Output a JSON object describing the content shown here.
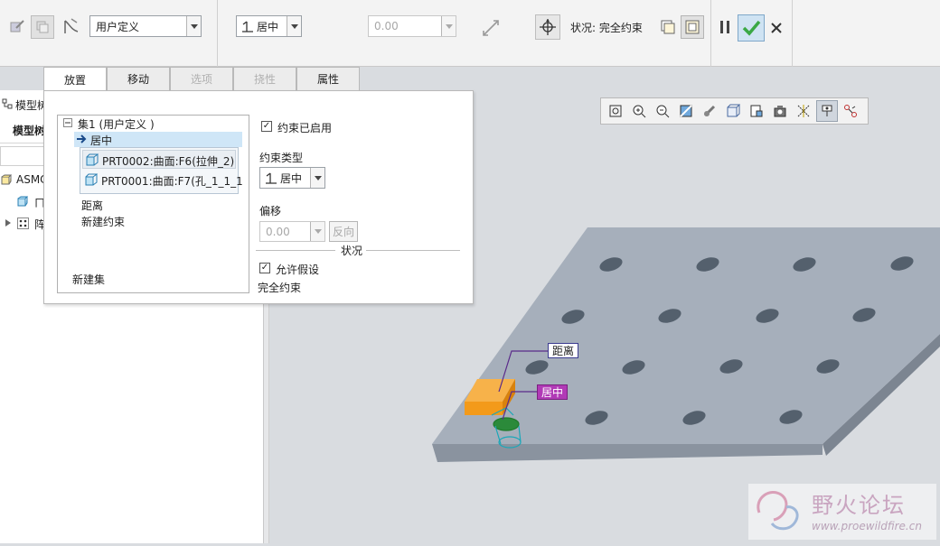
{
  "ribbon": {
    "constraint_set_value": "用户定义",
    "constraint_type_value": "居中",
    "offset_value": "0.00",
    "status_label": "状况: 完全约束"
  },
  "tabs": [
    {
      "label": "放置",
      "state": "active"
    },
    {
      "label": "移动",
      "state": "normal"
    },
    {
      "label": "选项",
      "state": "disabled"
    },
    {
      "label": "挠性",
      "state": "disabled"
    },
    {
      "label": "属性",
      "state": "normal"
    }
  ],
  "tree": {
    "title": "模型树",
    "tab_label": "模型树",
    "root": "ASMC",
    "child1": "ㄇ",
    "child2": "阵"
  },
  "panel": {
    "set_label": "集1 (用户定义 )",
    "selected_constraint": "居中",
    "refs": [
      "PRT0002:曲面:F6(拉伸_2)",
      "PRT0001:曲面:F7(孔_1_1_1"
    ],
    "distance_label": "距离",
    "new_constraint": "新建约束",
    "new_set": "新建集",
    "constraint_enabled": "约束已启用",
    "constraint_type_label": "约束类型",
    "constraint_type_value": "居中",
    "offset_label": "偏移",
    "offset_value": "0.00",
    "flip_label": "反向",
    "status_heading": "状况",
    "allow_assumptions": "允许假设",
    "status_text": "完全约束"
  },
  "canvas": {
    "tag_distance": "距离",
    "tag_center": "居中"
  },
  "watermark": {
    "title": "野火论坛",
    "url": "www.proewildfire.cn"
  },
  "colors": {
    "plate": "#a6afbb",
    "plate_side": "#8a939f",
    "hole": "#54606d",
    "accent_ok": "#3aa845",
    "part_orange": "#f39a1a",
    "tag_center_bg": "#b13ab6"
  }
}
